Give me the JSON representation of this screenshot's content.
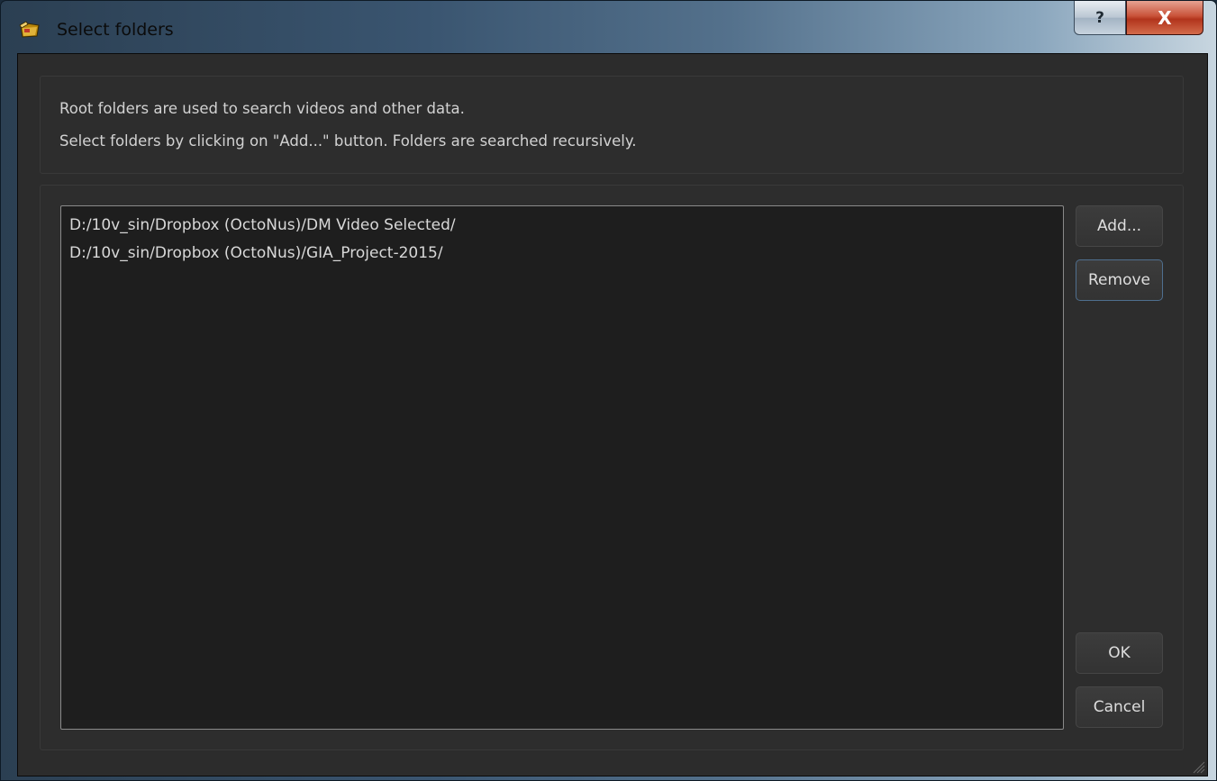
{
  "window": {
    "title": "Select folders",
    "help_label": "?",
    "close_label": "X"
  },
  "info": {
    "line1": "Root folders are used to search videos and other data.",
    "line2": "Select folders by clicking on \"Add...\" button. Folders are searched recursively."
  },
  "folders": [
    "D:/10v_sin/Dropbox (OctoNus)/DM Video Selected/",
    "D:/10v_sin/Dropbox (OctoNus)/GIA_Project-2015/"
  ],
  "buttons": {
    "add": "Add...",
    "remove": "Remove",
    "ok": "OK",
    "cancel": "Cancel"
  },
  "icons": {
    "app": "app-folder-icon",
    "help": "help-icon",
    "close": "close-icon",
    "grip": "resize-grip-icon"
  },
  "colors": {
    "client_bg": "#2c2c2c",
    "list_bg": "#1e1e1e",
    "text": "#d2d2d2",
    "close_red": "#c9533a",
    "focus_border": "#4f6f8f"
  }
}
